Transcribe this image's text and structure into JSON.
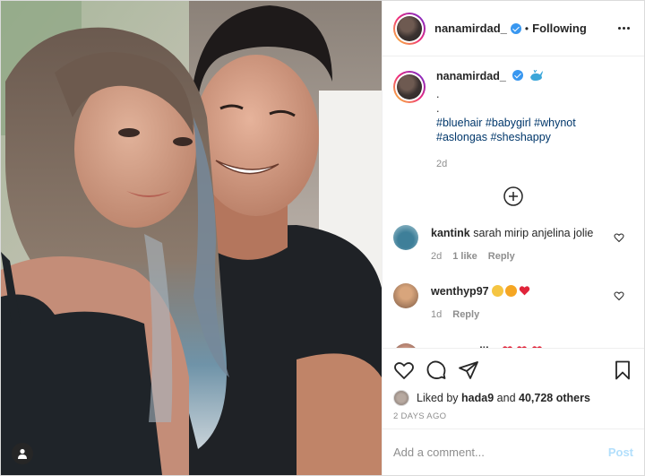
{
  "header": {
    "username": "nanamirdad_",
    "separator": "•",
    "follow_status": "Following"
  },
  "caption": {
    "username": "nanamirdad_",
    "lines": [
      ".",
      "."
    ],
    "hashtags_line1": [
      "#bluehair",
      "#babygirl",
      "#whynot"
    ],
    "hashtags_line2": [
      "#aslongas",
      "#sheshappy"
    ],
    "time": "2d"
  },
  "comments": [
    {
      "username": "kantink",
      "text": "sarah mirip anjelina jolie",
      "time": "2d",
      "likes": "1 like",
      "reply_label": "Reply",
      "avatar_color": "#5a8fa8"
    },
    {
      "username": "wenthyp97",
      "text": "",
      "time": "1d",
      "likes": "",
      "reply_label": "Reply",
      "avatar_color": "#a86a44"
    },
    {
      "username": "agnesmalikx",
      "text": "",
      "avatar_color": "#8c5b4b"
    }
  ],
  "likes": {
    "prefix": "Liked by",
    "first_user": "hada9",
    "connector": "and",
    "count": "40,728 others"
  },
  "posted_time": "2 DAYS AGO",
  "add_comment": {
    "placeholder": "Add a comment...",
    "post_label": "Post"
  },
  "colors": {
    "verified": "#3897f0",
    "hashtag": "#00376b",
    "post_disabled": "#b2dffc",
    "heart_red": "#ed4956"
  }
}
